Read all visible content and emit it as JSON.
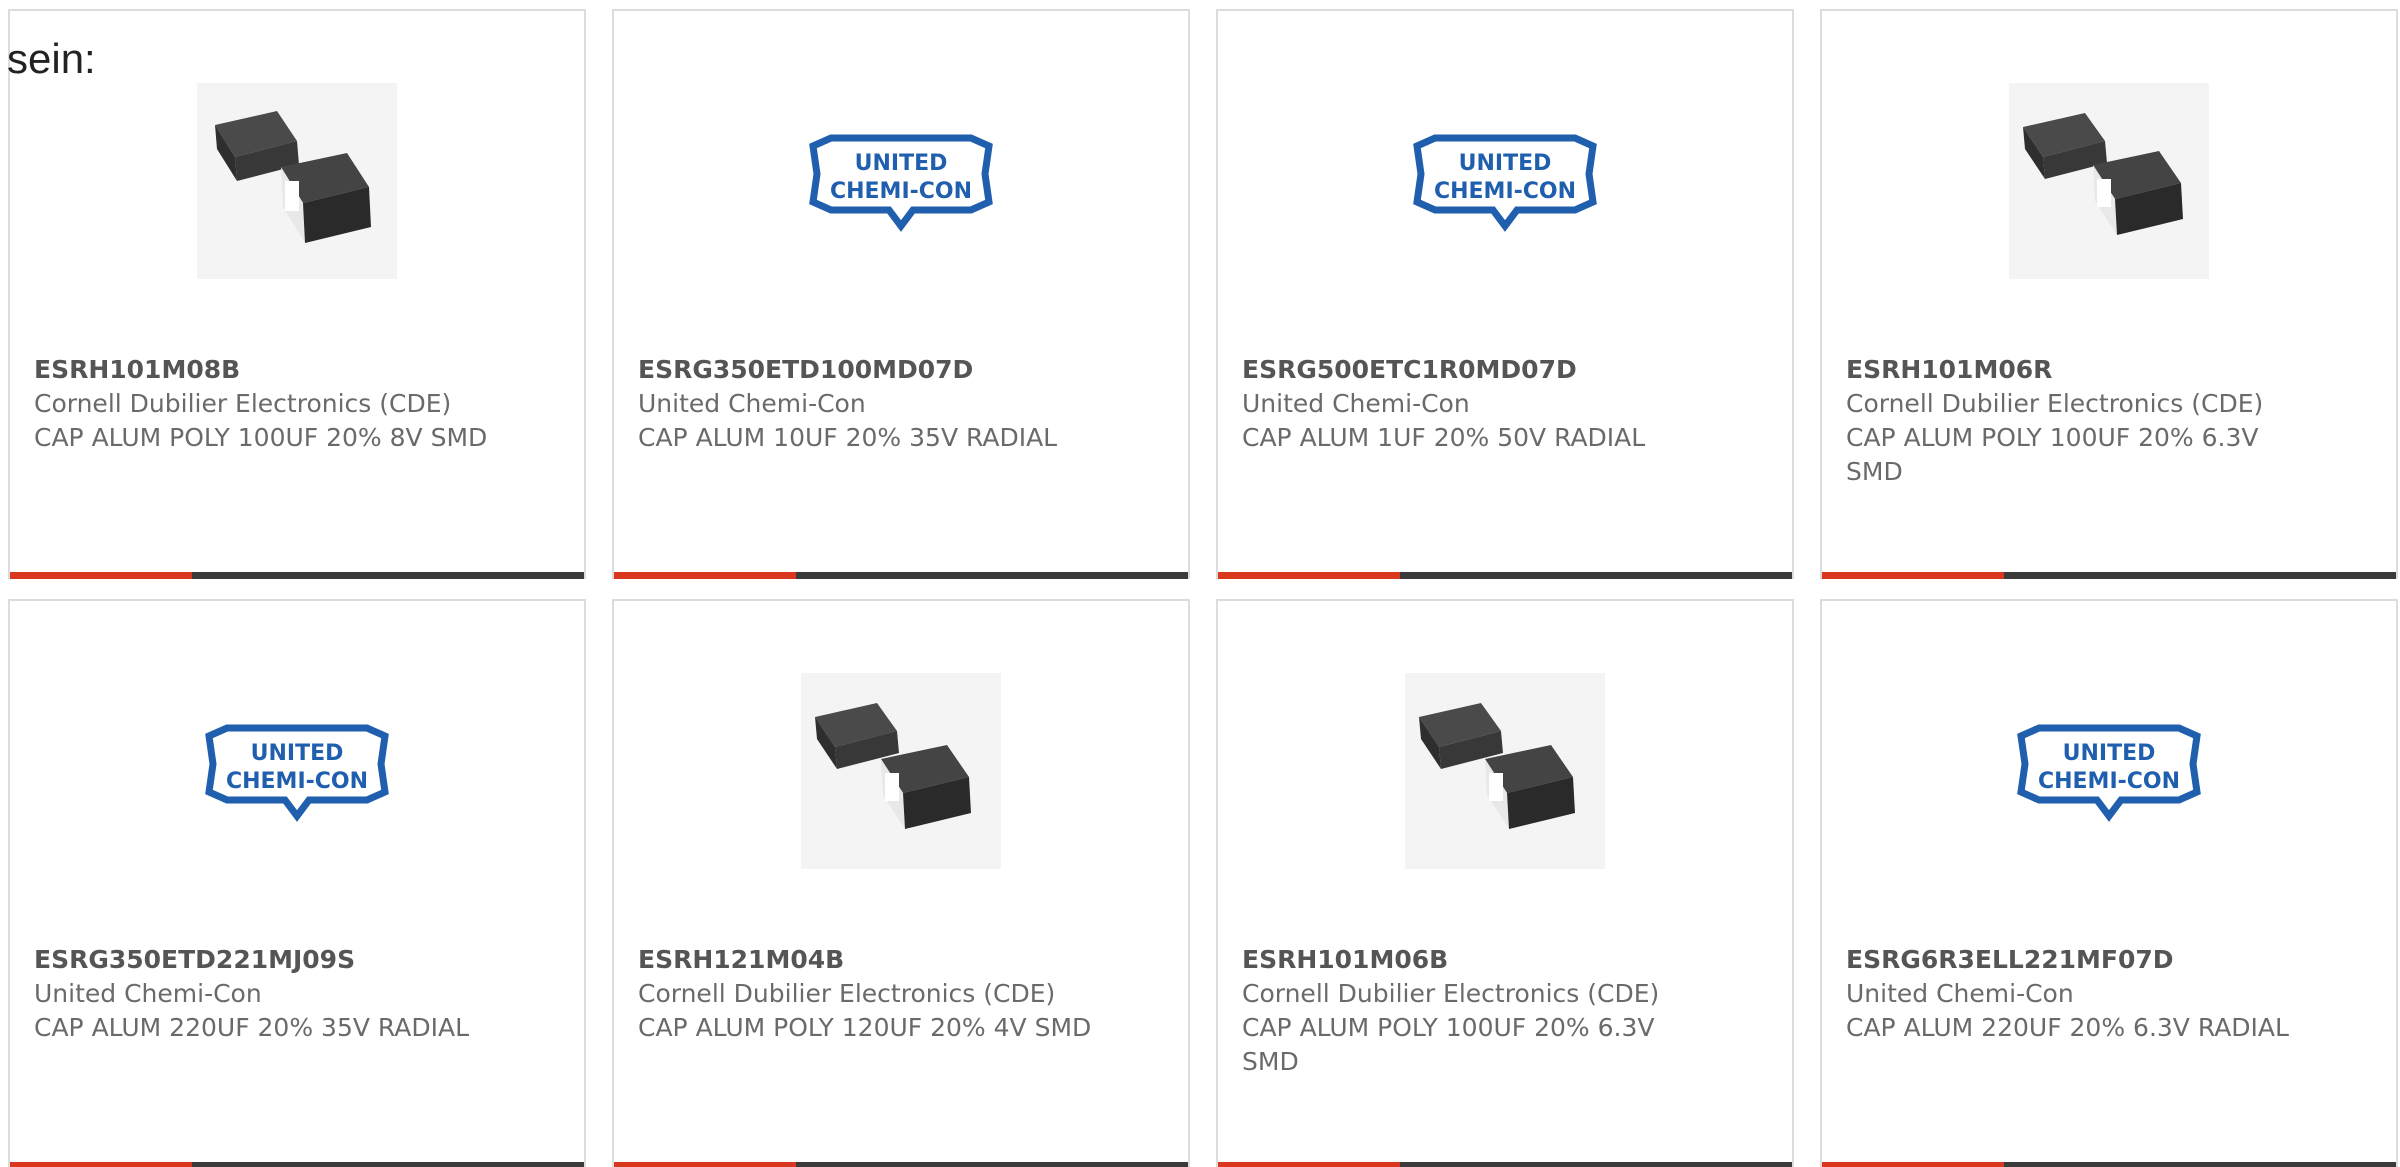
{
  "intro_text": "sein:",
  "colors": {
    "accent": "#d9381e",
    "bar": "#3a3a3a",
    "logo_blue": "#1f5fae"
  },
  "products": [
    {
      "part_number": "ESRH101M08B",
      "manufacturer": "Cornell Dubilier Electronics (CDE)",
      "description": "CAP ALUM POLY 100UF 20% 8V SMD",
      "image": "smd-capacitor-photo"
    },
    {
      "part_number": "ESRG350ETD100MD07D",
      "manufacturer": "United Chemi-Con",
      "description": "CAP ALUM 10UF 20% 35V RADIAL",
      "image": "united-chemi-con-logo",
      "logo_line1": "UNITED",
      "logo_line2": "CHEMI-CON"
    },
    {
      "part_number": "ESRG500ETC1R0MD07D",
      "manufacturer": "United Chemi-Con",
      "description": "CAP ALUM 1UF 20% 50V RADIAL",
      "image": "united-chemi-con-logo",
      "logo_line1": "UNITED",
      "logo_line2": "CHEMI-CON"
    },
    {
      "part_number": "ESRH101M06R",
      "manufacturer": "Cornell Dubilier Electronics (CDE)",
      "description": "CAP ALUM POLY 100UF 20% 6.3V SMD",
      "image": "smd-capacitor-photo"
    },
    {
      "part_number": "ESRG350ETD221MJ09S",
      "manufacturer": "United Chemi-Con",
      "description": "CAP ALUM 220UF 20% 35V RADIAL",
      "image": "united-chemi-con-logo",
      "logo_line1": "UNITED",
      "logo_line2": "CHEMI-CON"
    },
    {
      "part_number": "ESRH121M04B",
      "manufacturer": "Cornell Dubilier Electronics (CDE)",
      "description": "CAP ALUM POLY 120UF 20% 4V SMD",
      "image": "smd-capacitor-photo"
    },
    {
      "part_number": "ESRH101M06B",
      "manufacturer": "Cornell Dubilier Electronics (CDE)",
      "description": "CAP ALUM POLY 100UF 20% 6.3V SMD",
      "image": "smd-capacitor-photo"
    },
    {
      "part_number": "ESRG6R3ELL221MF07D",
      "manufacturer": "United Chemi-Con",
      "description": "CAP ALUM 220UF 20% 6.3V RADIAL",
      "image": "united-chemi-con-logo",
      "logo_line1": "UNITED",
      "logo_line2": "CHEMI-CON"
    }
  ]
}
